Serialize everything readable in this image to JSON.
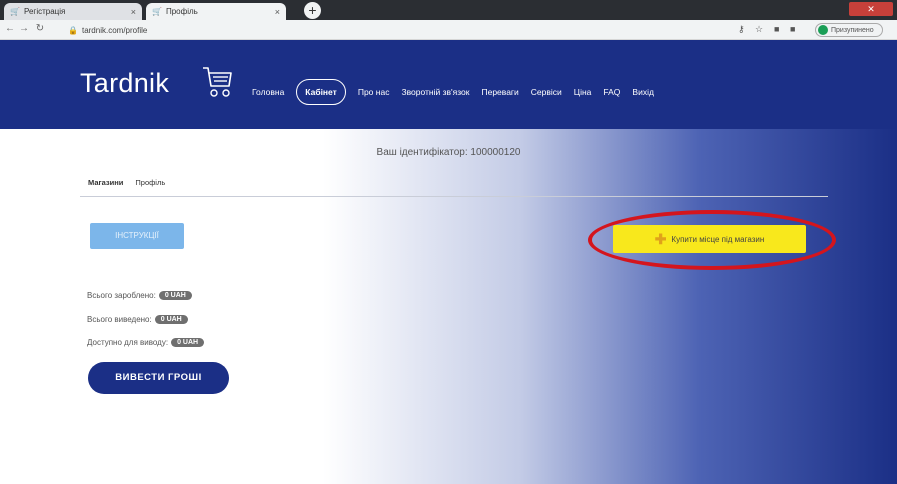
{
  "browser": {
    "tabs": [
      {
        "title": "Регістрація",
        "active": false
      },
      {
        "title": "Профіль",
        "active": true
      }
    ],
    "new_tab_glyph": "+",
    "url": "tardnik.com/profile",
    "profile_label": "Призупинено"
  },
  "header": {
    "logo_text": "Tardnik",
    "menu": [
      {
        "label": "Головна",
        "active": false
      },
      {
        "label": "Кабінет",
        "active": true
      },
      {
        "label": "Про нас",
        "active": false
      },
      {
        "label": "Зворотній зв'язок",
        "active": false
      },
      {
        "label": "Переваги",
        "active": false
      },
      {
        "label": "Сервіси",
        "active": false
      },
      {
        "label": "Ціна",
        "active": false
      },
      {
        "label": "FAQ",
        "active": false
      },
      {
        "label": "Вихід",
        "active": false
      }
    ]
  },
  "main": {
    "identifier_text": "Ваш ідентифікатор: 100000120",
    "tabs": [
      {
        "label": "Магазини",
        "active": true
      },
      {
        "label": "Профіль",
        "active": false
      }
    ],
    "instructions_label": "ІНСТРУКЦІЇ",
    "buy_button_label": "Купити місце під магазин",
    "stats": [
      {
        "label": "Всього заробленo:",
        "value": "0 UAH"
      },
      {
        "label": "Всього виведено:",
        "value": "0 UAH"
      },
      {
        "label": "Доступно для виводу:",
        "value": "0 UAH"
      }
    ],
    "withdraw_label": "ВИВЕСТИ ГРОШІ"
  },
  "colors": {
    "brand_navy": "#1b2f86",
    "accent_yellow": "#f8e81c",
    "highlight_red": "#d4151d",
    "instructions_blue": "#7cb6ea"
  }
}
